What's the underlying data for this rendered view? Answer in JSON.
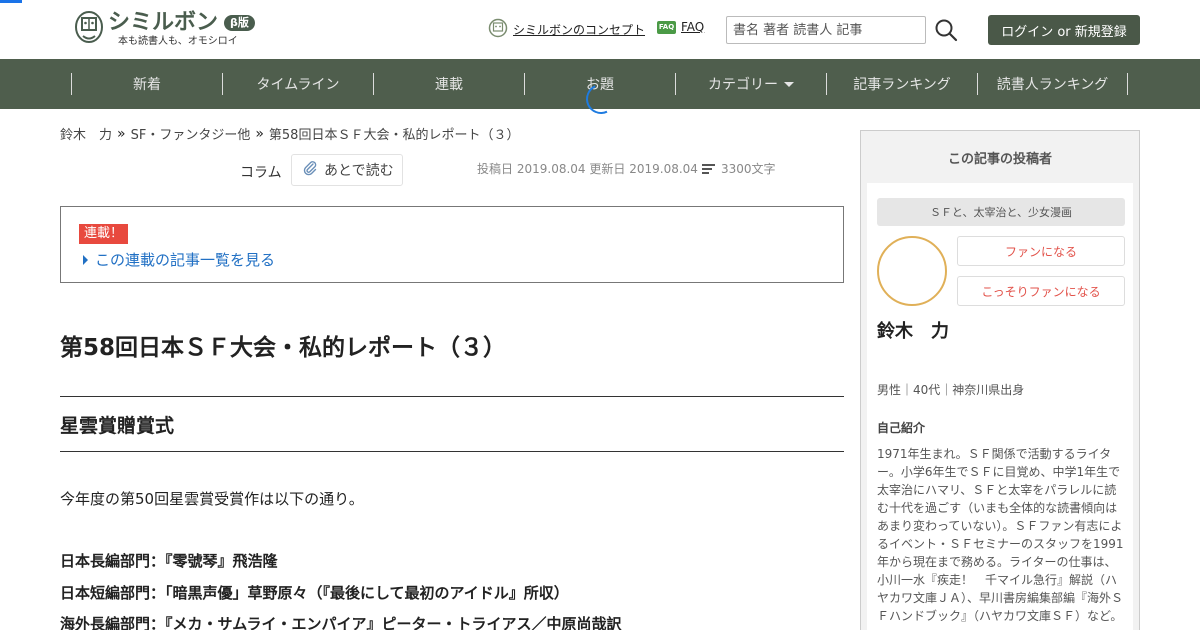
{
  "header": {
    "logo_name": "シミルボン",
    "logo_beta": "β版",
    "logo_tagline": "本も読書人も、オモシロイ",
    "concept_link": "シミルボンのコンセプト",
    "faq_badge": "FAQ",
    "faq_link": "FAQ",
    "search_placeholder": "書名 著者 読書人 記事",
    "login_button": "ログイン or 新規登録"
  },
  "nav": {
    "items": [
      "新着",
      "タイムライン",
      "連載",
      "お題",
      "カテゴリー",
      "記事ランキング",
      "読書人ランキング"
    ]
  },
  "breadcrumb": {
    "items": [
      "鈴木　力",
      "SF・ファンタジー他",
      "第58回日本ＳＦ大会・私的レポート（３）"
    ],
    "separator": "»"
  },
  "meta": {
    "column_label": "コラム",
    "read_later": "あとで読む",
    "posted_label": "投稿日",
    "posted_date": "2019.08.04",
    "updated_label": "更新日",
    "updated_date": "2019.08.04",
    "char_count": "3300文字"
  },
  "series": {
    "badge": "連載！",
    "link": "この連載の記事一覧を見る"
  },
  "article": {
    "title": "第58回日本ＳＦ大会・私的レポート（３）",
    "section_title": "星雲賞贈賞式",
    "paragraphs": [
      "今年度の第50回星雲賞受賞作は以下の通り。",
      "日本長編部門：『零號琴』飛浩隆",
      "日本短編部門：「暗黒声優」草野原々（『最後にして最初のアイドル』所収）",
      "海外長編部門：『メカ・サムライ・エンパイア』ピーター・トライアス／中原尚哉訳"
    ]
  },
  "sidebar": {
    "heading": "この記事の投稿者",
    "catchphrase": "ＳＦと、太宰治と、少女漫画",
    "fan_button": "ファンになる",
    "secret_fan_button": "こっそりファンになる",
    "author_name": "鈴木　力",
    "profile": "男性｜40代｜神奈川県出身",
    "intro_label": "自己紹介",
    "intro_text": "1971年生まれ。ＳＦ関係で活動するライター。小学6年生でＳＦに目覚め、中学1年生で太宰治にハマリ、ＳＦと太宰をパラレルに読む十代を過ごす（いまも全体的な読書傾向はあまり変わっていない）。ＳＦファン有志によるイベント・ＳＦセミナーのスタッフを1991年から現在まで務める。ライターの仕事は、小川一水『疾走！　千マイル急行』解説（ハヤカワ文庫ＪＡ）、早川書房編集部編『海外ＳＦハンドブック』（ハヤカワ文庫ＳＦ）など。"
  },
  "colors": {
    "nav_bg": "#4f5e4d",
    "accent_green": "#4a5848",
    "link_blue": "#2170c4",
    "badge_red": "#e8493e",
    "fan_red": "#e2524a",
    "avatar_ring": "#e0b058"
  }
}
